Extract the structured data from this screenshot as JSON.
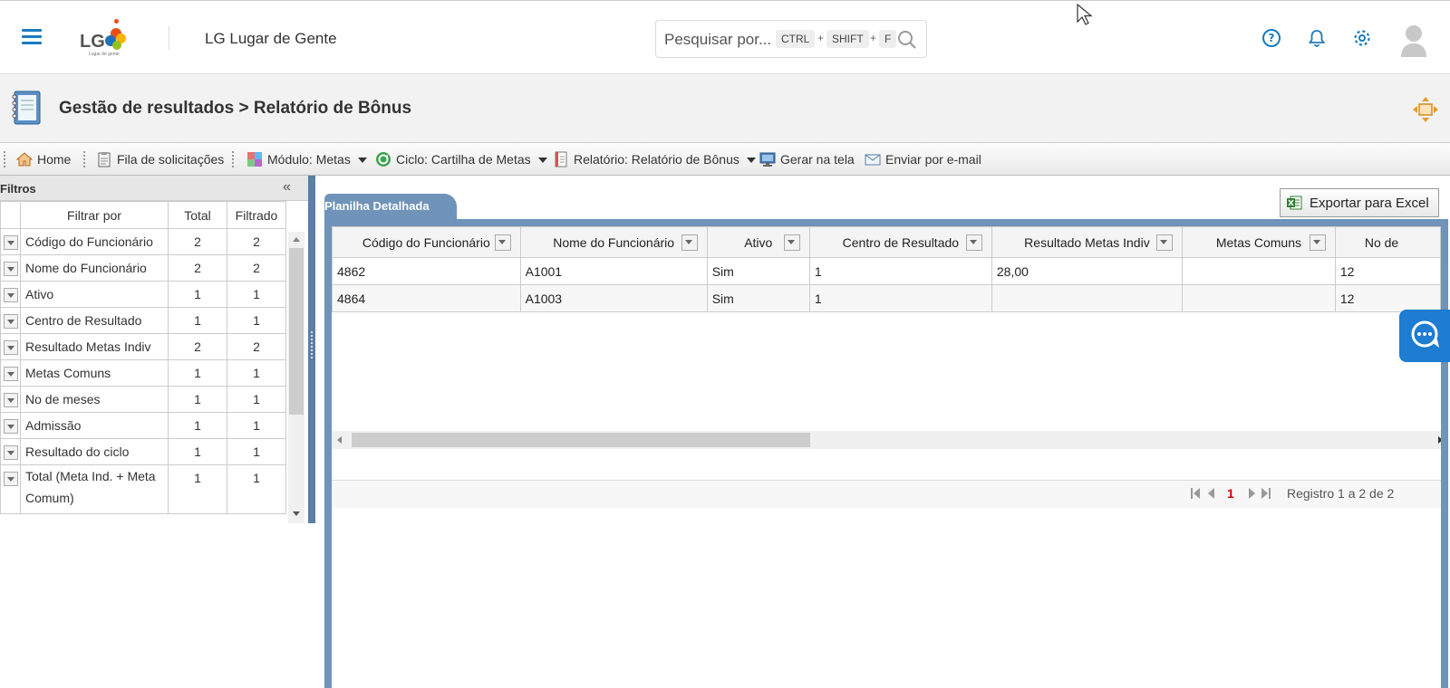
{
  "header": {
    "logo_text": "LG",
    "logo_subtitle": "Lugar de gente",
    "app_title": "LG Lugar de Gente",
    "search": {
      "placeholder": "Pesquisar por...",
      "keys": [
        "CTRL",
        "SHIFT",
        "F"
      ],
      "separator": "+"
    },
    "icons": [
      "menu-icon",
      "search-icon",
      "help-icon",
      "bell-icon",
      "gear-icon",
      "avatar"
    ],
    "accent_color": "#1a7bbf"
  },
  "title_bar": {
    "title": "Gestão de resultados > Relatório de Bônus"
  },
  "toolbar": {
    "items": [
      {
        "label": "Home",
        "icon": "home-icon"
      },
      {
        "label": "Fila de solicitações",
        "icon": "clipboard-icon"
      },
      {
        "label": "Módulo: Metas",
        "icon": "module-icon",
        "dropdown": true
      },
      {
        "label": "Ciclo: Cartilha de Metas",
        "icon": "cycle-icon",
        "dropdown": true
      },
      {
        "label": "Relatório: Relatório de Bônus",
        "icon": "report-icon",
        "dropdown": true
      },
      {
        "label": "Gerar na tela",
        "icon": "monitor-icon"
      },
      {
        "label": "Enviar por e-mail",
        "icon": "mail-icon"
      }
    ]
  },
  "filters": {
    "title": "Filtros",
    "collapse": "«",
    "columns": [
      "Filtrar por",
      "Total",
      "Filtrado"
    ],
    "rows": [
      {
        "name": "Código do Funcionário",
        "total": "2",
        "filtered": "2"
      },
      {
        "name": "Nome do Funcionário",
        "total": "2",
        "filtered": "2"
      },
      {
        "name": "Ativo",
        "total": "1",
        "filtered": "1"
      },
      {
        "name": "Centro de Resultado",
        "total": "1",
        "filtered": "1"
      },
      {
        "name": "Resultado Metas Indiv",
        "total": "2",
        "filtered": "2"
      },
      {
        "name": "Metas Comuns",
        "total": "1",
        "filtered": "1"
      },
      {
        "name": "No de meses",
        "total": "1",
        "filtered": "1"
      },
      {
        "name": "Admissão",
        "total": "1",
        "filtered": "1"
      },
      {
        "name": "Resultado do ciclo",
        "total": "1",
        "filtered": "1"
      },
      {
        "name": "Total (Meta Ind. + Meta Comum)",
        "total": "1",
        "filtered": "1"
      }
    ]
  },
  "main": {
    "tab_label": "Planilha Detalhada",
    "export_label": "Exportar para Excel",
    "grid": {
      "columns": [
        "Código do Funcionário",
        "Nome do Funcionário",
        "Ativo",
        "Centro de Resultado",
        "Resultado Metas Indiv",
        "Metas Comuns",
        "No de"
      ],
      "rows": [
        [
          "4862",
          "A1001",
          "Sim",
          "1",
          "28,00",
          "",
          "12"
        ],
        [
          "4864",
          "A1003",
          "Sim",
          "1",
          "",
          "",
          "12"
        ]
      ]
    },
    "pager": {
      "current_page": "1",
      "info": "Registro 1 a 2 de 2"
    }
  },
  "colors": {
    "frame": "#6f93b9",
    "chat": "#1e7cd1",
    "page_number": "#cc0000"
  }
}
